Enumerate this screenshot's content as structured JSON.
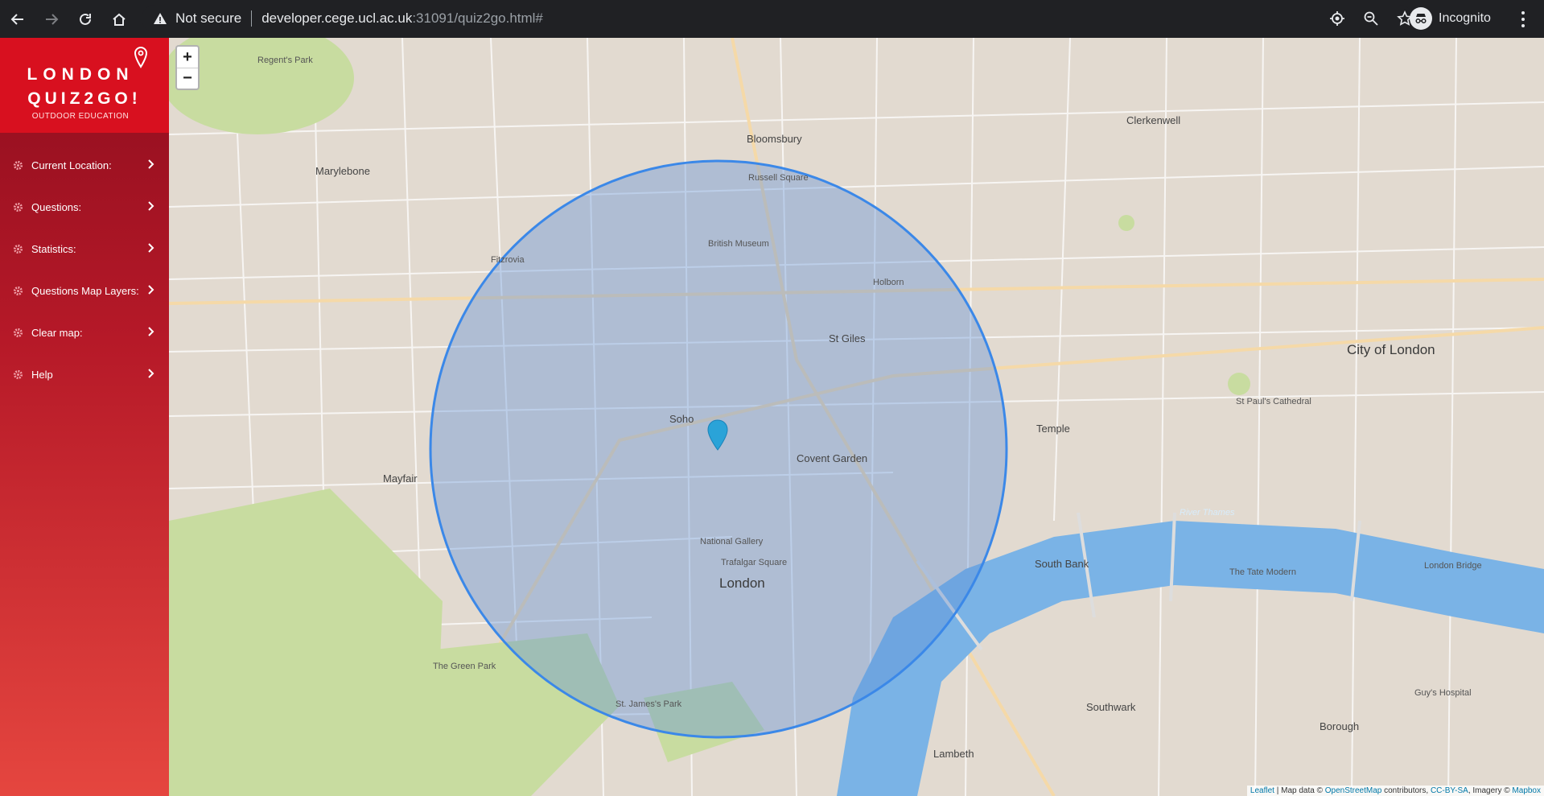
{
  "browser": {
    "security_label": "Not secure",
    "url_host": "developer.cege.ucl.ac.uk",
    "url_path": ":31091/quiz2go.html#",
    "profile_label": "Incognito"
  },
  "app": {
    "logo_line1": "LONDON",
    "logo_line2": "QUIZ2GO!",
    "logo_tagline": "OUTDOOR EDUCATION"
  },
  "sidebar": {
    "items": [
      {
        "label": "Current Location:"
      },
      {
        "label": "Questions:"
      },
      {
        "label": "Statistics:"
      },
      {
        "label": "Questions Map Layers:"
      },
      {
        "label": "Clear map:"
      },
      {
        "label": "Help"
      }
    ]
  },
  "map": {
    "zoom_in": "+",
    "zoom_out": "−",
    "labels": {
      "regents_park": "Regent's Park",
      "marylebone": "Marylebone",
      "bloomsbury": "Bloomsbury",
      "clerkenwell": "Clerkenwell",
      "fitzrovia": "Fitzrovia",
      "british_museum": "British Museum",
      "russell_square": "Russell Square",
      "holborn": "Holborn",
      "st_giles": "St Giles",
      "soho": "Soho",
      "covent_garden": "Covent Garden",
      "mayfair": "Mayfair",
      "london": "London",
      "city_of_london": "City of London",
      "temple": "Temple",
      "south_bank": "South Bank",
      "southwark": "Southwark",
      "lambeth": "Lambeth",
      "borough": "Borough",
      "green_park": "The Green Park",
      "st_james_park": "St. James's Park",
      "national_gallery": "National Gallery",
      "trafalgar_square": "Trafalgar Square",
      "st_pauls": "St Paul's Cathedral",
      "tate_modern": "The Tate Modern",
      "river_thames": "River Thames",
      "guys_hospital": "Guy's Hospital",
      "london_bridge": "London Bridge"
    },
    "attribution_leaflet": "Leaflet",
    "attribution_text": " | Map data © ",
    "attribution_osm": "OpenStreetMap",
    "attribution_contrib": " contributors, ",
    "attribution_license": "CC-BY-SA",
    "attribution_imagery": ", Imagery © ",
    "attribution_mapbox": "Mapbox",
    "colors": {
      "circle_stroke": "#3b88e8",
      "circle_fill": "#5c8fd8",
      "water": "#7ab3e6",
      "park": "#c8dca0",
      "sidebar_top": "#8e0d1e",
      "sidebar_bottom": "#e5463f",
      "logo_bg": "#d8101f"
    }
  }
}
